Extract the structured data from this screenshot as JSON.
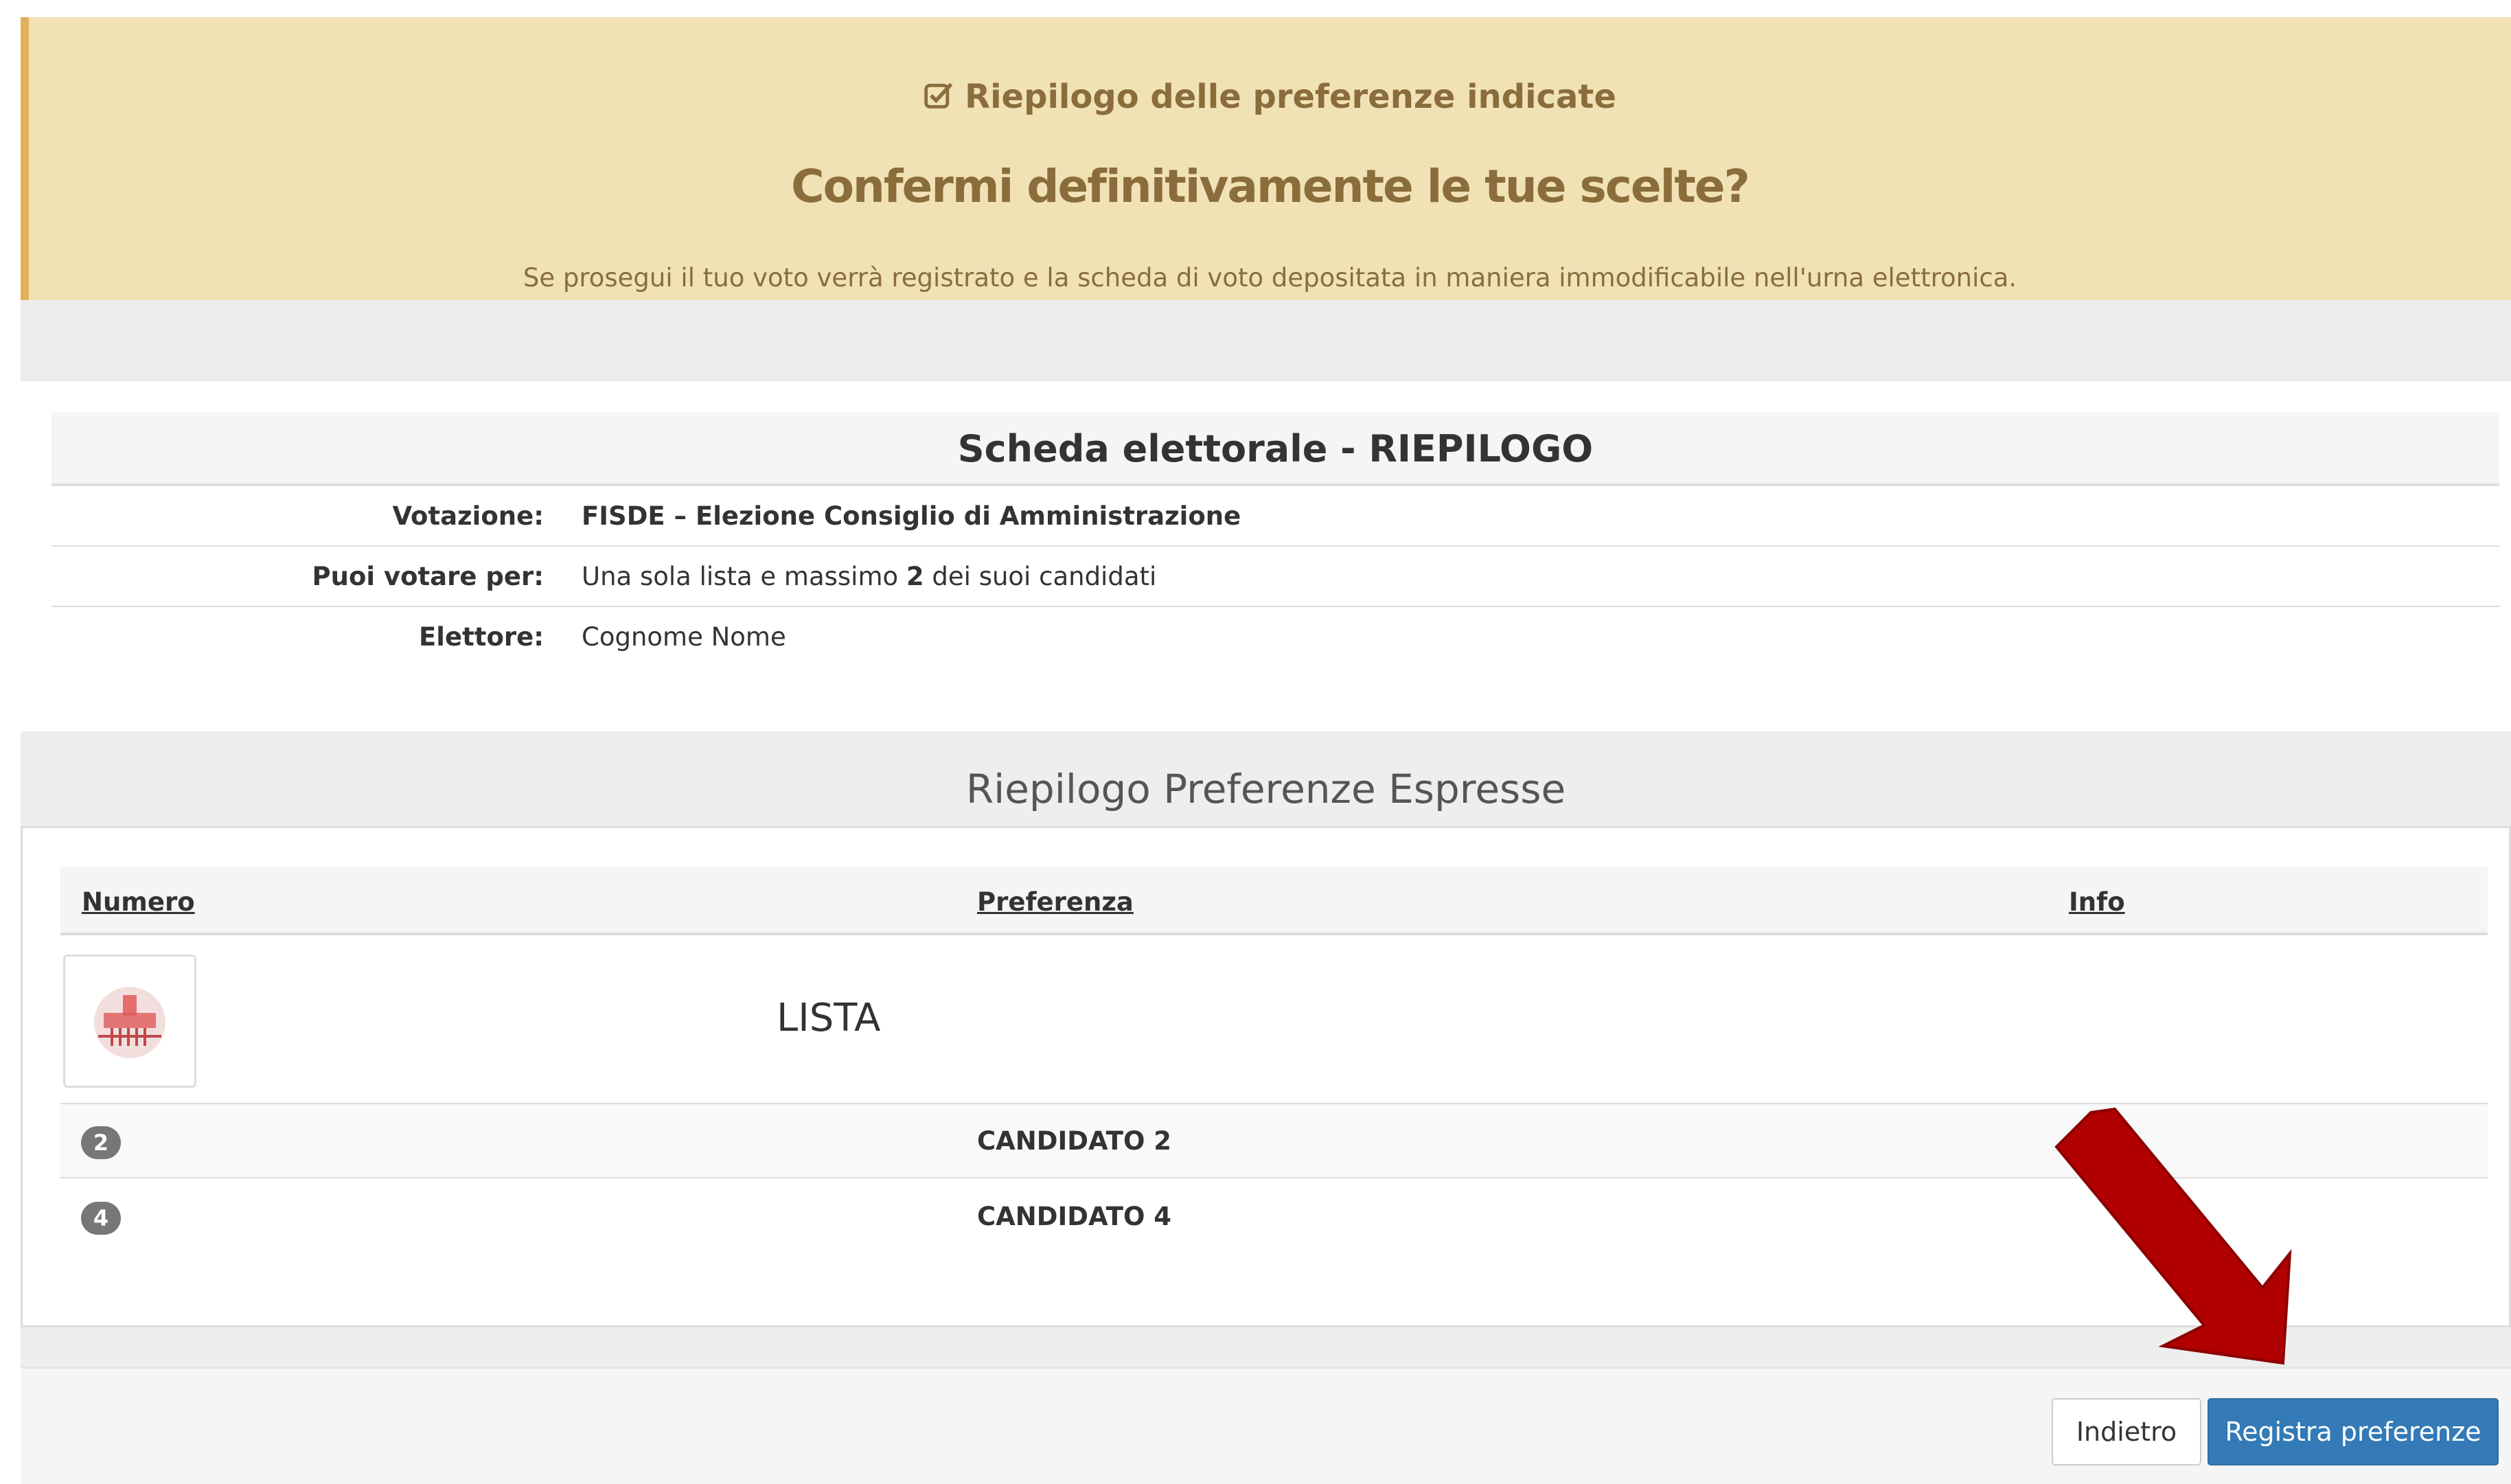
{
  "banner": {
    "title": "Riepilogo delle preferenze indicate",
    "question": "Confermi definitivamente le tue scelte?",
    "note": "Se prosegui il tuo voto verrà registrato e la scheda di voto depositata in maniera immodificabile nell'urna elettronica.",
    "icon": "check-square-icon"
  },
  "ballot": {
    "header": "Scheda elettorale - RIEPILOGO",
    "rows": [
      {
        "label": "Votazione:",
        "value": "FISDE – Elezione Consiglio di Amministrazione"
      },
      {
        "label": "Puoi votare per:",
        "value_pre": "Una sola lista e massimo ",
        "value_bold": "2",
        "value_post": " dei suoi candidati"
      },
      {
        "label": "Elettore:",
        "value": "Cognome Nome"
      }
    ]
  },
  "preferences": {
    "title": "Riepilogo Preferenze Espresse",
    "columns": [
      "Numero",
      "Preferenza",
      "Info"
    ],
    "list_label": "LISTA",
    "candidates": [
      {
        "number": "2",
        "name": "CANDIDATO 2"
      },
      {
        "number": "4",
        "name": "CANDIDATO 4"
      }
    ]
  },
  "buttons": {
    "back": "Indietro",
    "submit": "Registra preferenze"
  },
  "colors": {
    "banner_bg": "#f1e2b6",
    "banner_text": "#8a6d3b",
    "primary": "#337ab7",
    "arrow": "#b00000"
  }
}
